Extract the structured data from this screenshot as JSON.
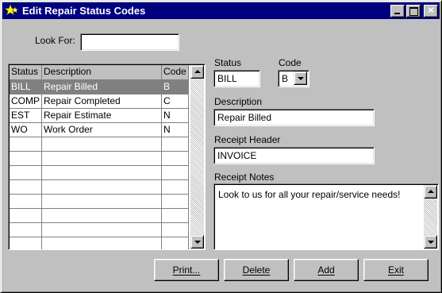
{
  "window": {
    "title": "Edit Repair Status Codes",
    "title_bar_color": "#000080",
    "icon": "star-app-icon",
    "controls": [
      "minimize-icon",
      "maximize-icon",
      "close-icon"
    ],
    "close_glyph": "×"
  },
  "search": {
    "label": "Look For:",
    "value": ""
  },
  "grid": {
    "headers": {
      "status": "Status",
      "description": "Description",
      "code": "Code"
    },
    "rows": [
      {
        "status": "BILL",
        "description": "Repair Billed",
        "code": "B",
        "selected": true
      },
      {
        "status": "COMP",
        "description": "Repair Completed",
        "code": "C"
      },
      {
        "status": "EST",
        "description": "Repair Estimate",
        "code": "N"
      },
      {
        "status": "WO",
        "description": "Work Order",
        "code": "N"
      }
    ],
    "selected_row_color": "#808080"
  },
  "detail": {
    "status_label": "Status",
    "status_value": "BILL",
    "code_label": "Code",
    "code_value": "B",
    "description_label": "Description",
    "description_value": "Repair Billed",
    "receipt_header_label": "Receipt Header",
    "receipt_header_value": "INVOICE",
    "receipt_notes_label": "Receipt Notes",
    "receipt_notes_value": "Look to us for all your repair/service needs!"
  },
  "buttons": {
    "print": "Print...",
    "delete": "Delete",
    "add": "Add",
    "exit": "Exit"
  }
}
